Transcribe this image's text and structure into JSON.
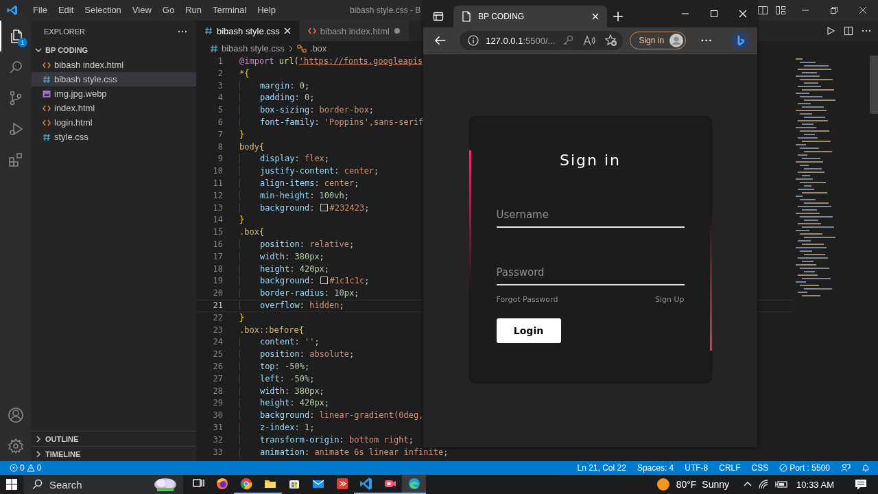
{
  "editor": {
    "menu": [
      "File",
      "Edit",
      "Selection",
      "View",
      "Go",
      "Run",
      "Terminal",
      "Help"
    ],
    "title": "bibash style.css - B",
    "activity_badge": "1",
    "explorer": {
      "title": "EXPLORER",
      "folder": "BP CODING",
      "files": [
        {
          "name": "bibash index.html",
          "kind": "html",
          "selected": false
        },
        {
          "name": "bibash style.css",
          "kind": "css",
          "selected": true
        },
        {
          "name": "img.jpg.webp",
          "kind": "image",
          "selected": false
        },
        {
          "name": "index.html",
          "kind": "html",
          "selected": false
        },
        {
          "name": "login.html",
          "kind": "html",
          "selected": false
        },
        {
          "name": "style.css",
          "kind": "css",
          "selected": false
        }
      ]
    },
    "sections": [
      "OUTLINE",
      "TIMELINE"
    ],
    "tabs": [
      {
        "label": "bibash style.css",
        "kind": "css",
        "selected": true,
        "modified": false
      },
      {
        "label": "bibash index.html",
        "kind": "html",
        "selected": false,
        "modified": true
      }
    ],
    "breadcrumb": {
      "file": "bibash style.css",
      "symbol": ".box"
    },
    "code": [
      {
        "n": "1",
        "text": "@import url('https://fonts.googleapis",
        "current": false
      },
      {
        "n": "2",
        "text": "*{",
        "current": false
      },
      {
        "n": "3",
        "text": "    margin: 0;",
        "current": false
      },
      {
        "n": "4",
        "text": "    padding: 0;",
        "current": false
      },
      {
        "n": "5",
        "text": "    box-sizing: border-box;",
        "current": false
      },
      {
        "n": "6",
        "text": "    font-family: 'Poppins',sans-serif",
        "current": false
      },
      {
        "n": "7",
        "text": "}",
        "current": false
      },
      {
        "n": "8",
        "text": "body{",
        "current": false
      },
      {
        "n": "9",
        "text": "    display: flex;",
        "current": false
      },
      {
        "n": "10",
        "text": "    justify-content: center;",
        "current": false
      },
      {
        "n": "11",
        "text": "    align-items: center;",
        "current": false
      },
      {
        "n": "12",
        "text": "    min-height: 100vh;",
        "current": false
      },
      {
        "n": "13",
        "text": "    background: #232423;",
        "current": false
      },
      {
        "n": "14",
        "text": "}",
        "current": false
      },
      {
        "n": "15",
        "text": ".box{",
        "current": false
      },
      {
        "n": "16",
        "text": "    position: relative;",
        "current": false
      },
      {
        "n": "17",
        "text": "    width: 380px;",
        "current": false
      },
      {
        "n": "18",
        "text": "    height: 420px;",
        "current": false
      },
      {
        "n": "19",
        "text": "    background: #1c1c1c;",
        "current": false
      },
      {
        "n": "20",
        "text": "    border-radius: 10px;",
        "current": false
      },
      {
        "n": "21",
        "text": "    overflow: hidden;",
        "current": true
      },
      {
        "n": "22",
        "text": "}",
        "current": false
      },
      {
        "n": "23",
        "text": ".box::before{",
        "current": false
      },
      {
        "n": "24",
        "text": "    content: '';",
        "current": false
      },
      {
        "n": "25",
        "text": "    position: absolute;",
        "current": false
      },
      {
        "n": "26",
        "text": "    top: -50%;",
        "current": false
      },
      {
        "n": "27",
        "text": "    left: -50%;",
        "current": false
      },
      {
        "n": "28",
        "text": "    width: 380px;",
        "current": false
      },
      {
        "n": "29",
        "text": "    height: 420px;",
        "current": false
      },
      {
        "n": "30",
        "text": "    background: linear-gradient(0deg,",
        "current": false
      },
      {
        "n": "31",
        "text": "    z-index: 1;",
        "current": false
      },
      {
        "n": "32",
        "text": "    transform-origin: bottom right;",
        "current": false
      },
      {
        "n": "33",
        "text": "    animation: animate 6s linear infinite;",
        "current": false
      }
    ]
  },
  "browser": {
    "tab_title": "BP CODING",
    "url_host": "127.0.0.1",
    "url_rest": ":5500/...",
    "profile_button": "Sign in",
    "page": {
      "heading": "Sign in",
      "fields": [
        {
          "placeholder": "Username"
        },
        {
          "placeholder": "Password"
        }
      ],
      "links": [
        "Forgot Password",
        "Sign Up"
      ],
      "button": "Login"
    }
  },
  "status_bar": {
    "errors": "0",
    "warnings": "0",
    "items": [
      "Ln 21, Col 22",
      "Spaces: 4",
      "UTF-8",
      "CRLF",
      "CSS"
    ],
    "port": "Port : 5500"
  },
  "taskbar": {
    "search": "Search",
    "apps": [
      {
        "kind": "taskview",
        "running": false,
        "active": false
      },
      {
        "kind": "firefox",
        "running": false,
        "active": false
      },
      {
        "kind": "chrome",
        "running": true,
        "active": false
      },
      {
        "kind": "folder",
        "running": true,
        "active": false
      },
      {
        "kind": "store",
        "running": false,
        "active": false
      },
      {
        "kind": "mail",
        "running": false,
        "active": false
      },
      {
        "kind": "remote",
        "running": false,
        "active": false
      },
      {
        "kind": "vscode",
        "running": true,
        "active": false
      },
      {
        "kind": "camera",
        "running": true,
        "active": false
      },
      {
        "kind": "edge",
        "running": true,
        "active": true
      }
    ],
    "temperature": "80°F",
    "weather": "Sunny",
    "time": "10:33 AM"
  }
}
